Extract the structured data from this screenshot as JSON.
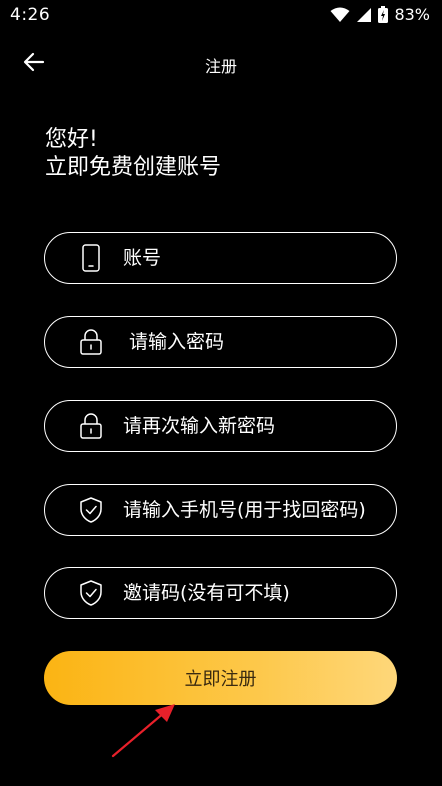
{
  "status_bar": {
    "time": "4:26",
    "battery_percent": "83%"
  },
  "header": {
    "title": "注册"
  },
  "greeting": {
    "line1": "您好!",
    "line2": "立即免费创建账号"
  },
  "form": {
    "fields": [
      {
        "icon": "phone-icon",
        "placeholder": "账号"
      },
      {
        "icon": "lock-icon",
        "placeholder": "请输入密码"
      },
      {
        "icon": "lock-icon",
        "placeholder": "请再次输入新密码"
      },
      {
        "icon": "shield-check-icon",
        "placeholder": "请输入手机号(用于找回密码)"
      },
      {
        "icon": "shield-check-icon",
        "placeholder": "邀请码(没有可不填)"
      }
    ],
    "submit_label": "立即注册"
  },
  "colors": {
    "background": "#000000",
    "button_gradient_start": "#fbb413",
    "button_gradient_end": "#fed77a",
    "annotation_arrow": "#e8202a"
  }
}
